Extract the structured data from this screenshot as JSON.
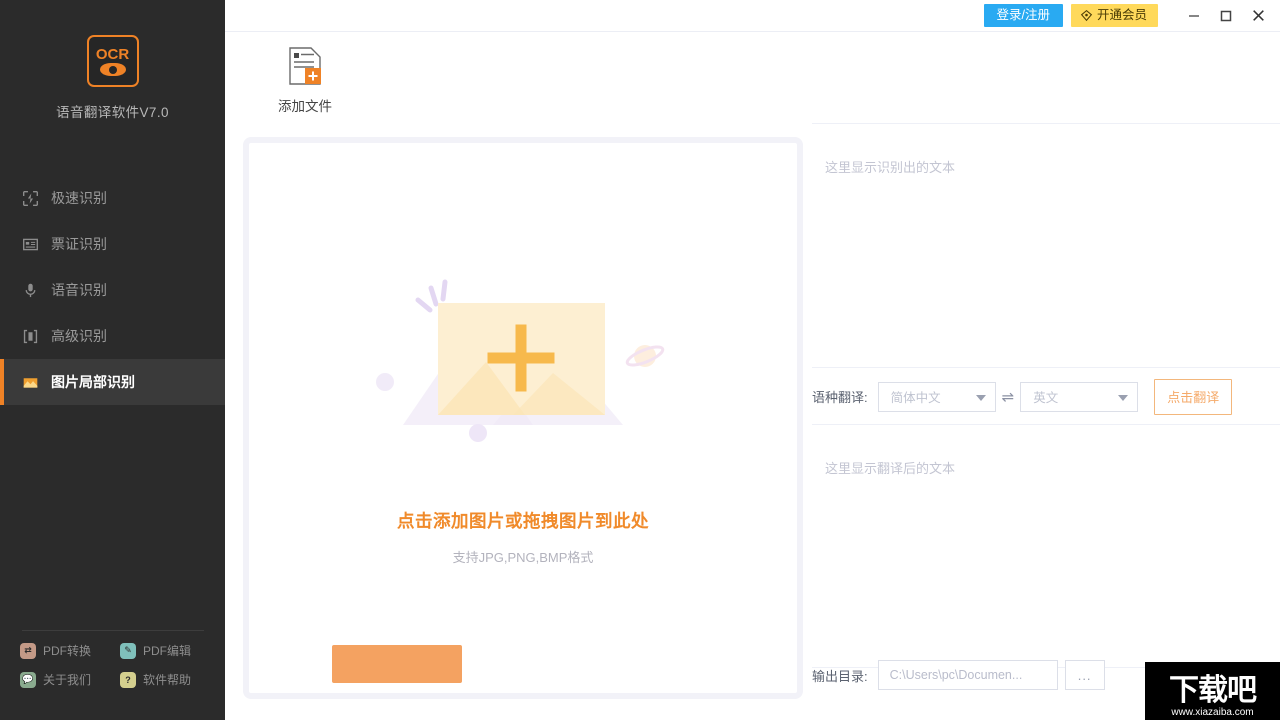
{
  "sidebar": {
    "logo_text": "OCR",
    "app_name": "语音翻译软件V7.0",
    "items": [
      {
        "label": "极速识别",
        "icon": "fast-recognition-icon",
        "active": false
      },
      {
        "label": "票证识别",
        "icon": "ticket-recognition-icon",
        "active": false
      },
      {
        "label": "语音识别",
        "icon": "microphone-icon",
        "active": false
      },
      {
        "label": "高级识别",
        "icon": "advanced-recognition-icon",
        "active": false
      },
      {
        "label": "图片局部识别",
        "icon": "image-region-icon",
        "active": true
      }
    ],
    "tools": [
      {
        "label": "PDF转换",
        "icon": "pdf-convert-icon",
        "color": "#c49a87"
      },
      {
        "label": "PDF编辑",
        "icon": "pdf-edit-icon",
        "color": "#7fc0bb"
      },
      {
        "label": "关于我们",
        "icon": "about-us-icon",
        "color": "#8aab8f"
      },
      {
        "label": "软件帮助",
        "icon": "help-icon",
        "color": "#d4cf8e"
      }
    ]
  },
  "titlebar": {
    "login_label": "登录/注册",
    "vip_label": "开通会员",
    "minimize": "—",
    "maximize": "☐",
    "close": "✕"
  },
  "toolbar": {
    "add_file_label": "添加文件"
  },
  "dropzone": {
    "title": "点击添加图片或拖拽图片到此处",
    "subtitle": "支持JPG,PNG,BMP格式"
  },
  "right_panel": {
    "ocr_placeholder": "这里显示识别出的文本",
    "translated_placeholder": "这里显示翻译后的文本",
    "translate_label": "语种翻译:",
    "source_lang": "简体中文",
    "target_lang": "英文",
    "swap_icon": "⇌",
    "translate_button": "点击翻译",
    "output_label": "输出目录:",
    "output_path": "C:\\Users\\pc\\Documen...",
    "browse_label": "...",
    "start_button": ""
  },
  "watermark": {
    "text_cn": "下载吧",
    "url": "www.xiazaiba.com"
  },
  "colors": {
    "accent": "#ef8226",
    "sidebar_bg": "#2b2b2b",
    "sidebar_active_bg": "#3a3a3a",
    "login_blue": "#29aaf2",
    "vip_yellow": "#ffd95b",
    "drop_title": "#f08a2a",
    "panel_border": "#f2f2f8"
  }
}
